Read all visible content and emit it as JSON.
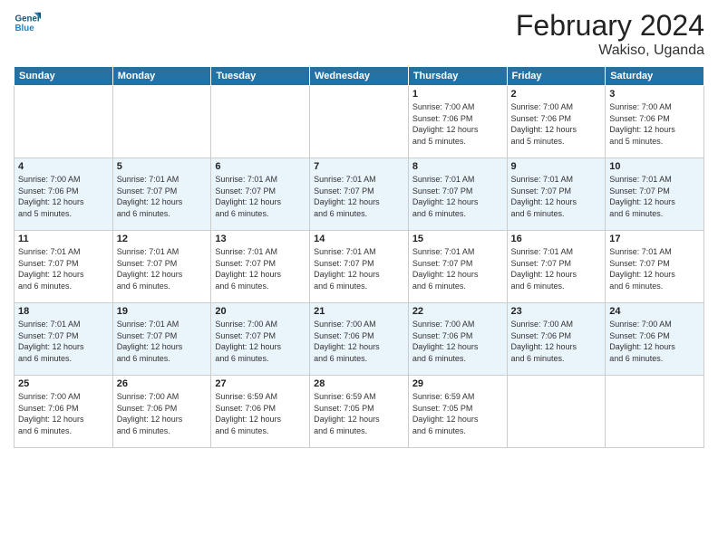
{
  "logo": {
    "line1": "General",
    "line2": "Blue"
  },
  "title": "February 2024",
  "location": "Wakiso, Uganda",
  "days_of_week": [
    "Sunday",
    "Monday",
    "Tuesday",
    "Wednesday",
    "Thursday",
    "Friday",
    "Saturday"
  ],
  "weeks": [
    [
      {
        "day": "",
        "info": ""
      },
      {
        "day": "",
        "info": ""
      },
      {
        "day": "",
        "info": ""
      },
      {
        "day": "",
        "info": ""
      },
      {
        "day": "1",
        "info": "Sunrise: 7:00 AM\nSunset: 7:06 PM\nDaylight: 12 hours\nand 5 minutes."
      },
      {
        "day": "2",
        "info": "Sunrise: 7:00 AM\nSunset: 7:06 PM\nDaylight: 12 hours\nand 5 minutes."
      },
      {
        "day": "3",
        "info": "Sunrise: 7:00 AM\nSunset: 7:06 PM\nDaylight: 12 hours\nand 5 minutes."
      }
    ],
    [
      {
        "day": "4",
        "info": "Sunrise: 7:00 AM\nSunset: 7:06 PM\nDaylight: 12 hours\nand 5 minutes."
      },
      {
        "day": "5",
        "info": "Sunrise: 7:01 AM\nSunset: 7:07 PM\nDaylight: 12 hours\nand 6 minutes."
      },
      {
        "day": "6",
        "info": "Sunrise: 7:01 AM\nSunset: 7:07 PM\nDaylight: 12 hours\nand 6 minutes."
      },
      {
        "day": "7",
        "info": "Sunrise: 7:01 AM\nSunset: 7:07 PM\nDaylight: 12 hours\nand 6 minutes."
      },
      {
        "day": "8",
        "info": "Sunrise: 7:01 AM\nSunset: 7:07 PM\nDaylight: 12 hours\nand 6 minutes."
      },
      {
        "day": "9",
        "info": "Sunrise: 7:01 AM\nSunset: 7:07 PM\nDaylight: 12 hours\nand 6 minutes."
      },
      {
        "day": "10",
        "info": "Sunrise: 7:01 AM\nSunset: 7:07 PM\nDaylight: 12 hours\nand 6 minutes."
      }
    ],
    [
      {
        "day": "11",
        "info": "Sunrise: 7:01 AM\nSunset: 7:07 PM\nDaylight: 12 hours\nand 6 minutes."
      },
      {
        "day": "12",
        "info": "Sunrise: 7:01 AM\nSunset: 7:07 PM\nDaylight: 12 hours\nand 6 minutes."
      },
      {
        "day": "13",
        "info": "Sunrise: 7:01 AM\nSunset: 7:07 PM\nDaylight: 12 hours\nand 6 minutes."
      },
      {
        "day": "14",
        "info": "Sunrise: 7:01 AM\nSunset: 7:07 PM\nDaylight: 12 hours\nand 6 minutes."
      },
      {
        "day": "15",
        "info": "Sunrise: 7:01 AM\nSunset: 7:07 PM\nDaylight: 12 hours\nand 6 minutes."
      },
      {
        "day": "16",
        "info": "Sunrise: 7:01 AM\nSunset: 7:07 PM\nDaylight: 12 hours\nand 6 minutes."
      },
      {
        "day": "17",
        "info": "Sunrise: 7:01 AM\nSunset: 7:07 PM\nDaylight: 12 hours\nand 6 minutes."
      }
    ],
    [
      {
        "day": "18",
        "info": "Sunrise: 7:01 AM\nSunset: 7:07 PM\nDaylight: 12 hours\nand 6 minutes."
      },
      {
        "day": "19",
        "info": "Sunrise: 7:01 AM\nSunset: 7:07 PM\nDaylight: 12 hours\nand 6 minutes."
      },
      {
        "day": "20",
        "info": "Sunrise: 7:00 AM\nSunset: 7:07 PM\nDaylight: 12 hours\nand 6 minutes."
      },
      {
        "day": "21",
        "info": "Sunrise: 7:00 AM\nSunset: 7:06 PM\nDaylight: 12 hours\nand 6 minutes."
      },
      {
        "day": "22",
        "info": "Sunrise: 7:00 AM\nSunset: 7:06 PM\nDaylight: 12 hours\nand 6 minutes."
      },
      {
        "day": "23",
        "info": "Sunrise: 7:00 AM\nSunset: 7:06 PM\nDaylight: 12 hours\nand 6 minutes."
      },
      {
        "day": "24",
        "info": "Sunrise: 7:00 AM\nSunset: 7:06 PM\nDaylight: 12 hours\nand 6 minutes."
      }
    ],
    [
      {
        "day": "25",
        "info": "Sunrise: 7:00 AM\nSunset: 7:06 PM\nDaylight: 12 hours\nand 6 minutes."
      },
      {
        "day": "26",
        "info": "Sunrise: 7:00 AM\nSunset: 7:06 PM\nDaylight: 12 hours\nand 6 minutes."
      },
      {
        "day": "27",
        "info": "Sunrise: 6:59 AM\nSunset: 7:06 PM\nDaylight: 12 hours\nand 6 minutes."
      },
      {
        "day": "28",
        "info": "Sunrise: 6:59 AM\nSunset: 7:05 PM\nDaylight: 12 hours\nand 6 minutes."
      },
      {
        "day": "29",
        "info": "Sunrise: 6:59 AM\nSunset: 7:05 PM\nDaylight: 12 hours\nand 6 minutes."
      },
      {
        "day": "",
        "info": ""
      },
      {
        "day": "",
        "info": ""
      }
    ]
  ]
}
